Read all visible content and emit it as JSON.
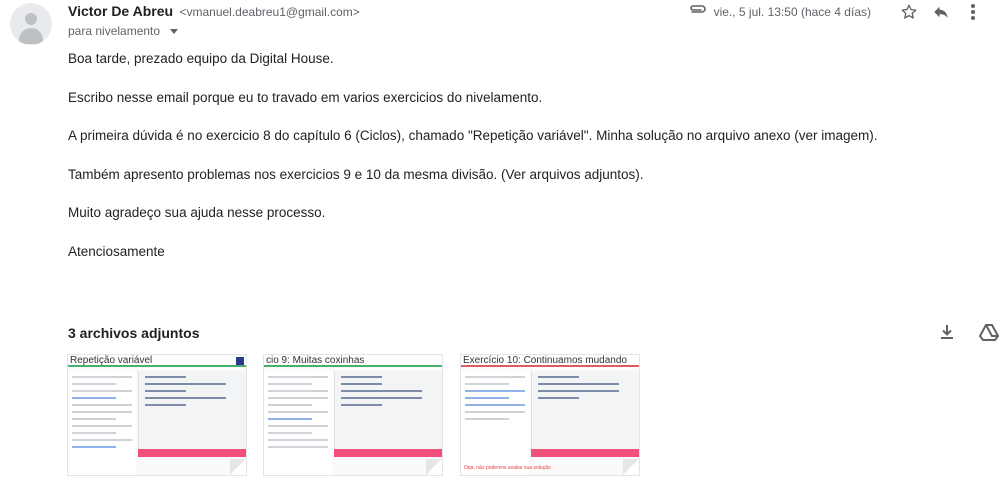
{
  "sender": {
    "name": "Victor De Abreu",
    "email": "<vmanuel.deabreu1@gmail.com>",
    "avatar_icon": "person-icon"
  },
  "recipient": {
    "label": "para nivelamento"
  },
  "meta": {
    "date": "vie., 5 jul. 13:50 (hace 4 días)",
    "icons": [
      "paperclip-icon",
      "star-icon",
      "reply-icon",
      "more-vert-icon"
    ]
  },
  "body": {
    "paragraphs": [
      "Boa tarde, prezado equipo da Digital House.",
      "Escribo nesse email porque eu to travado em varios exercicios do nivelamento.",
      "A primeira dúvida é no exercicio 8 do capítulo 6 (Ciclos), chamado \"Repetição variável\". Minha solução no arquivo anexo (ver imagem).",
      "Também apresento problemas nos exercicios 9 e 10 da mesma divisão. (Ver arquivos adjuntos).",
      "Muito agradeço sua ajuda nesse processo.",
      "Atenciosamente"
    ]
  },
  "attachments": {
    "title": "3 archivos adjuntos",
    "action_icons": [
      "download-all-icon",
      "save-to-drive-icon"
    ],
    "items": [
      {
        "thumb_title": "Repetição variável"
      },
      {
        "thumb_title": "cio 9:  Muitas coxinhas"
      },
      {
        "thumb_title": "Exercício 10:  Continuamos mudando",
        "error_text": "Opa, não podemos avaliar sua solução"
      }
    ]
  },
  "colors": {
    "accent_green": "#48b06e",
    "run_button_pink": "#f0507a",
    "text_dark": "#222222",
    "text_muted": "#5f6368"
  }
}
